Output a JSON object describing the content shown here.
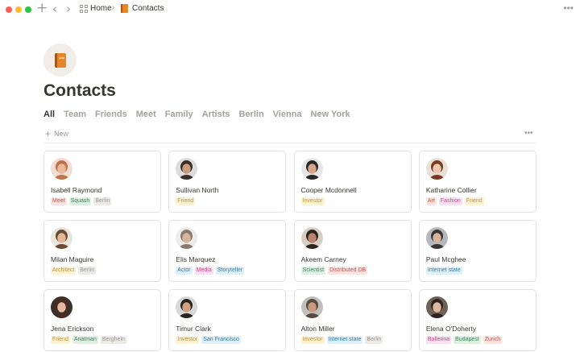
{
  "breadcrumb": {
    "home": "Home",
    "separator": "›",
    "current": "Contacts"
  },
  "page": {
    "title": "Contacts"
  },
  "tabs": [
    "All",
    "Team",
    "Friends",
    "Meet",
    "Family",
    "Artists",
    "Berlin",
    "Vienna",
    "New York"
  ],
  "toolbar": {
    "new_label": "New",
    "plus": "+",
    "more": "•••"
  },
  "contacts": [
    {
      "name": "Isabell Raymond",
      "skin": "#e9b99a",
      "hair": "#c0734a",
      "bg": "#f3ddd2",
      "tags": [
        {
          "label": "Meet",
          "color": "red"
        },
        {
          "label": "Squash",
          "color": "green"
        },
        {
          "label": "Berlin",
          "color": "gray"
        }
      ]
    },
    {
      "name": "Sullivan North",
      "skin": "#c89b7e",
      "hair": "#3a2e27",
      "bg": "#dcdcdc",
      "tags": [
        {
          "label": "Friend",
          "color": "yellow"
        }
      ]
    },
    {
      "name": "Cooper Mcdonnell",
      "skin": "#d6a488",
      "hair": "#2a2520",
      "bg": "#e6e6e6",
      "tags": [
        {
          "label": "Investor",
          "color": "yellow"
        }
      ]
    },
    {
      "name": "Katharine Collier",
      "skin": "#f0c8b0",
      "hair": "#7a3a1f",
      "bg": "#e8e0d6",
      "tags": [
        {
          "label": "Art",
          "color": "red"
        },
        {
          "label": "Fashion",
          "color": "pink"
        },
        {
          "label": "Friend",
          "color": "yellow"
        }
      ]
    },
    {
      "name": "Milan Maguire",
      "skin": "#e4b896",
      "hair": "#6a4a33",
      "bg": "#e8e4de",
      "tags": [
        {
          "label": "Architect",
          "color": "yellow"
        },
        {
          "label": "Berlin",
          "color": "gray"
        }
      ]
    },
    {
      "name": "Elis Marquez",
      "skin": "#d9b49c",
      "hair": "#8a7a6c",
      "bg": "#ececec",
      "tags": [
        {
          "label": "Actor",
          "color": "blue"
        },
        {
          "label": "Media",
          "color": "pink"
        },
        {
          "label": "Storyteller",
          "color": "blue"
        }
      ]
    },
    {
      "name": "Akeem Carney",
      "skin": "#b98468",
      "hair": "#2d2420",
      "bg": "#d7cfc5",
      "tags": [
        {
          "label": "Scientist",
          "color": "green"
        },
        {
          "label": "Distributed DB",
          "color": "red"
        }
      ]
    },
    {
      "name": "Paul Mcghee",
      "skin": "#d8b39c",
      "hair": "#3a3532",
      "bg": "#b6b9bc",
      "tags": [
        {
          "label": "Internet state",
          "color": "blue"
        }
      ]
    },
    {
      "name": "Jena Erickson",
      "skin": "#e6b89e",
      "hair": "#4a2c20",
      "bg": "#3b302a",
      "tags": [
        {
          "label": "Friend",
          "color": "yellow"
        },
        {
          "label": "Anatman",
          "color": "green"
        },
        {
          "label": "Berghein",
          "color": "gray"
        }
      ]
    },
    {
      "name": "Timur Clark",
      "skin": "#d2a184",
      "hair": "#2a2420",
      "bg": "#d8d8d8",
      "tags": [
        {
          "label": "Investor",
          "color": "yellow"
        },
        {
          "label": "San Francisco",
          "color": "blue"
        }
      ]
    },
    {
      "name": "Alton Miller",
      "skin": "#c99a80",
      "hair": "#5a4a40",
      "bg": "#bfbfbf",
      "tags": [
        {
          "label": "Investor",
          "color": "yellow"
        },
        {
          "label": "Internet state",
          "color": "blue"
        },
        {
          "label": "Berlin",
          "color": "gray"
        }
      ]
    },
    {
      "name": "Elena O'Doherty",
      "skin": "#e0b8a0",
      "hair": "#2e231e",
      "bg": "#6e6258",
      "tags": [
        {
          "label": "Ballerina",
          "color": "pink"
        },
        {
          "label": "Budapest",
          "color": "green"
        },
        {
          "label": "Zurich",
          "color": "red"
        }
      ]
    }
  ],
  "tag_colors": {
    "red": {
      "bg": "#fbe4e1",
      "fg": "#c4554d"
    },
    "green": {
      "bg": "#dff0e3",
      "fg": "#448361"
    },
    "gray": {
      "bg": "#ebeae7",
      "fg": "#9b9a97"
    },
    "yellow": {
      "bg": "#fbf3d4",
      "fg": "#c29343"
    },
    "pink": {
      "bg": "#f9e2ef",
      "fg": "#c14c8a"
    },
    "blue": {
      "bg": "#dfeff8",
      "fg": "#337ea9"
    }
  },
  "icons": {
    "page": "book-icon",
    "traffic_lights": [
      "close",
      "minimize",
      "zoom"
    ]
  }
}
